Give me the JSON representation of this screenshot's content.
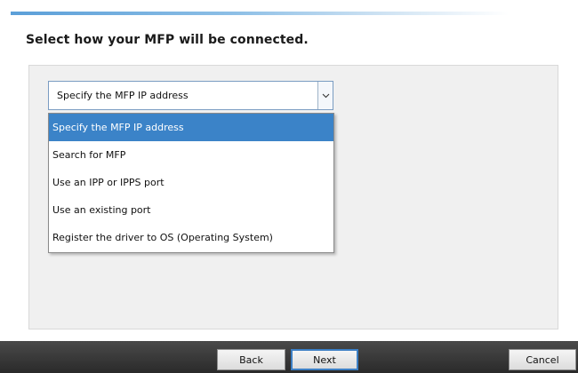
{
  "heading": "Select how your MFP will be connected.",
  "connection_select": {
    "selected_value": "Specify the MFP IP address",
    "arrow_icon": "chevron-down-icon",
    "options": [
      "Specify the MFP IP address",
      "Search for MFP",
      "Use an IPP or IPPS port",
      "Use an existing port",
      "Register the driver to OS (Operating System)"
    ],
    "highlighted_index": 0
  },
  "footer": {
    "back_label": "Back",
    "next_label": "Next",
    "cancel_label": "Cancel"
  },
  "colors": {
    "highlight": "#3b83c8",
    "footer_bar": "#2f2f2f",
    "panel_bg": "#f0f0f0",
    "default_button_border": "#3c7fc4"
  }
}
